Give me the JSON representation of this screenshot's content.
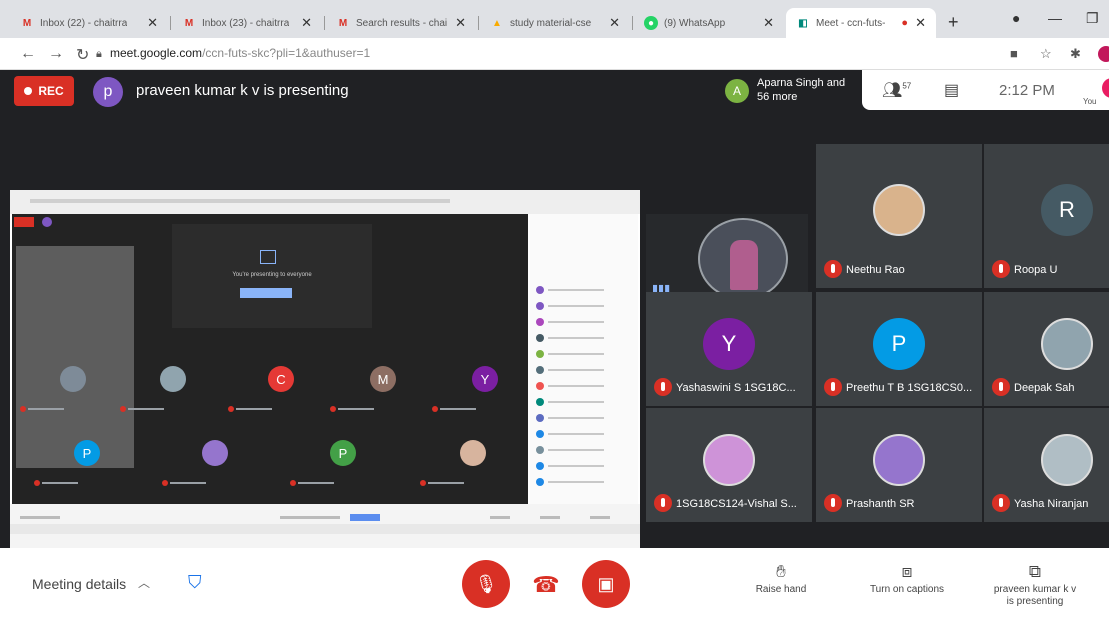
{
  "browser": {
    "tabs": [
      {
        "title": "Inbox (22) - chaitrra",
        "favicon": "gmail-icon"
      },
      {
        "title": "Inbox (23) - chaitrra",
        "favicon": "gmail-icon"
      },
      {
        "title": "Search results - chai",
        "favicon": "gmail-icon"
      },
      {
        "title": "study material-cse",
        "favicon": "drive-icon"
      },
      {
        "title": "(9) WhatsApp",
        "favicon": "whatsapp-icon"
      },
      {
        "title": "Meet - ccn-futs-",
        "favicon": "meet-icon"
      }
    ],
    "active_tab": 5,
    "url_host": "meet.google.com",
    "url_path": "/ccn-futs-skc?pli=1&authuser=1"
  },
  "meet": {
    "rec_label": "REC",
    "presenter_initial": "p",
    "presenter_text": "praveen kumar k v is presenting",
    "others_initial": "A",
    "others_text": "Aparna Singh and 56 more",
    "people_count": "57",
    "time": "2:12 PM",
    "you_label": "You"
  },
  "presented_screen": {
    "presenting_text": "You're presenting to everyone"
  },
  "tiles": [
    {
      "name": "Neethu Rao",
      "initial": "",
      "avatar_color": "#d9b38c",
      "photo": true
    },
    {
      "name": "Roopa U",
      "initial": "R",
      "avatar_color": "#455a64",
      "photo": false
    },
    {
      "name": "Yashaswini S 1SG18C...",
      "initial": "Y",
      "avatar_color": "#7b1fa2",
      "photo": false
    },
    {
      "name": "Preethu T B 1SG18CS0...",
      "initial": "P",
      "avatar_color": "#039be5",
      "photo": false
    },
    {
      "name": "Deepak Sah",
      "initial": "",
      "avatar_color": "#90a4ae",
      "photo": true
    },
    {
      "name": "1SG18CS124-Vishal S...",
      "initial": "",
      "avatar_color": "#ce93d8",
      "photo": true
    },
    {
      "name": "Prashanth SR",
      "initial": "",
      "avatar_color": "#9575cd",
      "photo": true
    },
    {
      "name": "Yasha Niranjan",
      "initial": "",
      "avatar_color": "#b0bec5",
      "photo": true
    }
  ],
  "controls": {
    "meeting_details": "Meeting details",
    "raise_hand": "Raise hand",
    "captions": "Turn on captions",
    "presenting": "praveen kumar k v is presenting"
  },
  "colors": {
    "danger": "#d93025",
    "stage": "#202124",
    "tile": "#3c4043"
  }
}
